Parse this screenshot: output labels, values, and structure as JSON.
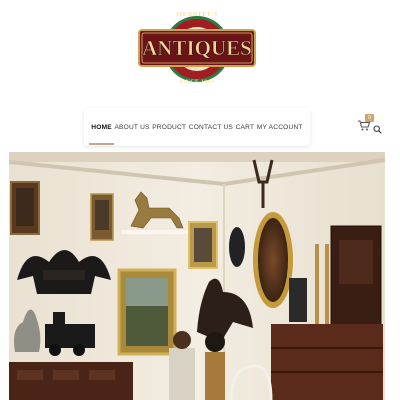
{
  "logo": {
    "word": "ANTIQUES",
    "arc_top": "MERRITT'S",
    "arc_bottom": "SINCE 1960"
  },
  "nav": {
    "items": [
      {
        "label": "HOME",
        "active": true
      },
      {
        "label": "ABOUT US",
        "active": false
      },
      {
        "label": "PRODUCT",
        "active": false
      },
      {
        "label": "CONTACT US",
        "active": false
      },
      {
        "label": "CART",
        "active": false
      },
      {
        "label": "MY ACCOUNT",
        "active": false
      }
    ]
  },
  "header_icons": {
    "cart": "cart-icon",
    "cart_count": "0",
    "search": "search-icon"
  },
  "colors": {
    "logo_red": "#8e1d1f",
    "logo_gold": "#e2c27a",
    "nav_underline": "#c7a38e",
    "badge": "#c9a86b"
  }
}
